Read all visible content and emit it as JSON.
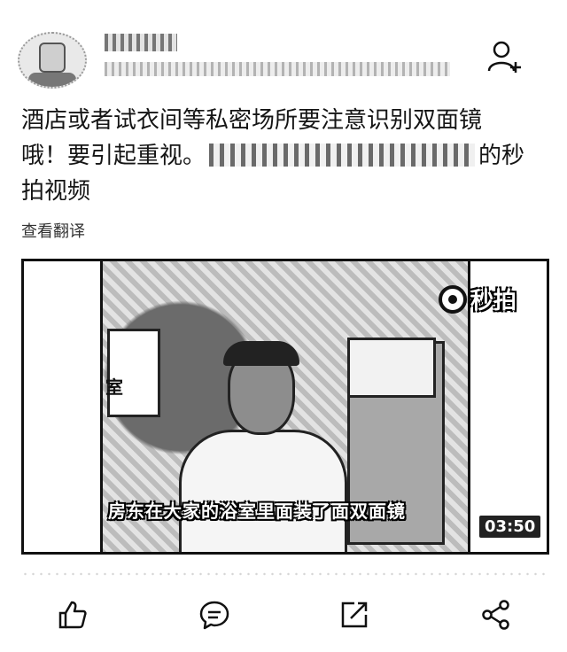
{
  "post": {
    "author_name": "",
    "meta": "",
    "text_line1": "酒店或者试衣间等私密场所要注意识别双面镜",
    "text_line2_a": "哦！要引起重视。",
    "text_line2_b": "的秒",
    "text_line3": "拍视频",
    "see_translation": "查看翻译"
  },
  "video": {
    "brand": "秒拍",
    "sign_text": "室",
    "subtitle": "房东在大家的浴室里面装了面双面镜",
    "duration": "03:50"
  },
  "actions": [
    {
      "icon": "like-icon"
    },
    {
      "icon": "comment-icon"
    },
    {
      "icon": "repost-icon"
    },
    {
      "icon": "share-icon"
    }
  ]
}
